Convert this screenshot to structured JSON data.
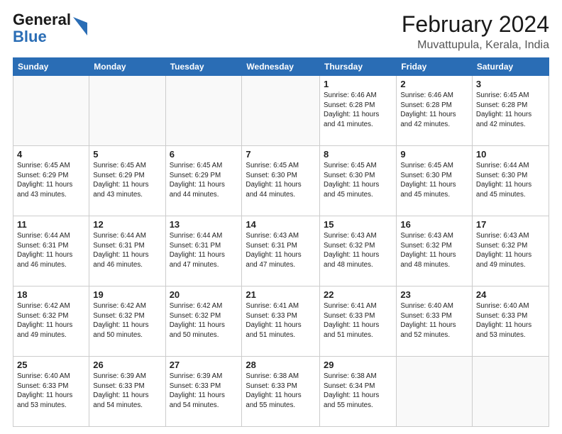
{
  "logo": {
    "general": "General",
    "blue": "Blue"
  },
  "title": "February 2024",
  "location": "Muvattupula, Kerala, India",
  "days_of_week": [
    "Sunday",
    "Monday",
    "Tuesday",
    "Wednesday",
    "Thursday",
    "Friday",
    "Saturday"
  ],
  "weeks": [
    [
      {
        "day": "",
        "info": ""
      },
      {
        "day": "",
        "info": ""
      },
      {
        "day": "",
        "info": ""
      },
      {
        "day": "",
        "info": ""
      },
      {
        "day": "1",
        "info": "Sunrise: 6:46 AM\nSunset: 6:28 PM\nDaylight: 11 hours\nand 41 minutes."
      },
      {
        "day": "2",
        "info": "Sunrise: 6:46 AM\nSunset: 6:28 PM\nDaylight: 11 hours\nand 42 minutes."
      },
      {
        "day": "3",
        "info": "Sunrise: 6:45 AM\nSunset: 6:28 PM\nDaylight: 11 hours\nand 42 minutes."
      }
    ],
    [
      {
        "day": "4",
        "info": "Sunrise: 6:45 AM\nSunset: 6:29 PM\nDaylight: 11 hours\nand 43 minutes."
      },
      {
        "day": "5",
        "info": "Sunrise: 6:45 AM\nSunset: 6:29 PM\nDaylight: 11 hours\nand 43 minutes."
      },
      {
        "day": "6",
        "info": "Sunrise: 6:45 AM\nSunset: 6:29 PM\nDaylight: 11 hours\nand 44 minutes."
      },
      {
        "day": "7",
        "info": "Sunrise: 6:45 AM\nSunset: 6:30 PM\nDaylight: 11 hours\nand 44 minutes."
      },
      {
        "day": "8",
        "info": "Sunrise: 6:45 AM\nSunset: 6:30 PM\nDaylight: 11 hours\nand 45 minutes."
      },
      {
        "day": "9",
        "info": "Sunrise: 6:45 AM\nSunset: 6:30 PM\nDaylight: 11 hours\nand 45 minutes."
      },
      {
        "day": "10",
        "info": "Sunrise: 6:44 AM\nSunset: 6:30 PM\nDaylight: 11 hours\nand 45 minutes."
      }
    ],
    [
      {
        "day": "11",
        "info": "Sunrise: 6:44 AM\nSunset: 6:31 PM\nDaylight: 11 hours\nand 46 minutes."
      },
      {
        "day": "12",
        "info": "Sunrise: 6:44 AM\nSunset: 6:31 PM\nDaylight: 11 hours\nand 46 minutes."
      },
      {
        "day": "13",
        "info": "Sunrise: 6:44 AM\nSunset: 6:31 PM\nDaylight: 11 hours\nand 47 minutes."
      },
      {
        "day": "14",
        "info": "Sunrise: 6:43 AM\nSunset: 6:31 PM\nDaylight: 11 hours\nand 47 minutes."
      },
      {
        "day": "15",
        "info": "Sunrise: 6:43 AM\nSunset: 6:32 PM\nDaylight: 11 hours\nand 48 minutes."
      },
      {
        "day": "16",
        "info": "Sunrise: 6:43 AM\nSunset: 6:32 PM\nDaylight: 11 hours\nand 48 minutes."
      },
      {
        "day": "17",
        "info": "Sunrise: 6:43 AM\nSunset: 6:32 PM\nDaylight: 11 hours\nand 49 minutes."
      }
    ],
    [
      {
        "day": "18",
        "info": "Sunrise: 6:42 AM\nSunset: 6:32 PM\nDaylight: 11 hours\nand 49 minutes."
      },
      {
        "day": "19",
        "info": "Sunrise: 6:42 AM\nSunset: 6:32 PM\nDaylight: 11 hours\nand 50 minutes."
      },
      {
        "day": "20",
        "info": "Sunrise: 6:42 AM\nSunset: 6:32 PM\nDaylight: 11 hours\nand 50 minutes."
      },
      {
        "day": "21",
        "info": "Sunrise: 6:41 AM\nSunset: 6:33 PM\nDaylight: 11 hours\nand 51 minutes."
      },
      {
        "day": "22",
        "info": "Sunrise: 6:41 AM\nSunset: 6:33 PM\nDaylight: 11 hours\nand 51 minutes."
      },
      {
        "day": "23",
        "info": "Sunrise: 6:40 AM\nSunset: 6:33 PM\nDaylight: 11 hours\nand 52 minutes."
      },
      {
        "day": "24",
        "info": "Sunrise: 6:40 AM\nSunset: 6:33 PM\nDaylight: 11 hours\nand 53 minutes."
      }
    ],
    [
      {
        "day": "25",
        "info": "Sunrise: 6:40 AM\nSunset: 6:33 PM\nDaylight: 11 hours\nand 53 minutes."
      },
      {
        "day": "26",
        "info": "Sunrise: 6:39 AM\nSunset: 6:33 PM\nDaylight: 11 hours\nand 54 minutes."
      },
      {
        "day": "27",
        "info": "Sunrise: 6:39 AM\nSunset: 6:33 PM\nDaylight: 11 hours\nand 54 minutes."
      },
      {
        "day": "28",
        "info": "Sunrise: 6:38 AM\nSunset: 6:33 PM\nDaylight: 11 hours\nand 55 minutes."
      },
      {
        "day": "29",
        "info": "Sunrise: 6:38 AM\nSunset: 6:34 PM\nDaylight: 11 hours\nand 55 minutes."
      },
      {
        "day": "",
        "info": ""
      },
      {
        "day": "",
        "info": ""
      }
    ]
  ]
}
